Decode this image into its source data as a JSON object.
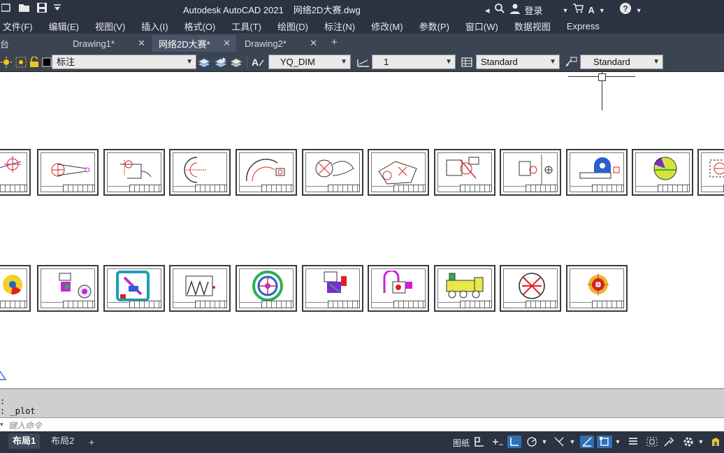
{
  "app": {
    "title": "Autodesk AutoCAD 2021",
    "document": "网络2D大赛.dwg",
    "login_label": "登录"
  },
  "menu": [
    "文件(F)",
    "编辑(E)",
    "视图(V)",
    "插入(I)",
    "格式(O)",
    "工具(T)",
    "绘图(D)",
    "标注(N)",
    "修改(M)",
    "参数(P)",
    "窗口(W)",
    "数据视图",
    "Express"
  ],
  "tabs": [
    {
      "label": "台",
      "active": false
    },
    {
      "label": "Drawing1*",
      "active": false
    },
    {
      "label": "网络2D大赛*",
      "active": true
    },
    {
      "label": "Drawing2*",
      "active": false
    }
  ],
  "toolbar": {
    "layer_value": "标注",
    "dimstyle_value": "YQ_DIM",
    "scale_value": "1",
    "tablestyle_value": "Standard",
    "mleaderstyle_value": "Standard"
  },
  "command_history": [
    ":",
    ": _plot"
  ],
  "command_placeholder": "键入命令",
  "layout_tabs": [
    {
      "label": "布局1",
      "active": true
    },
    {
      "label": "布局2",
      "active": false
    }
  ],
  "status": {
    "paper_label": "图纸"
  },
  "colors": {
    "titlebar": "#2b3242",
    "toolbar": "#3b4453",
    "accent": "#2f6fb4"
  }
}
